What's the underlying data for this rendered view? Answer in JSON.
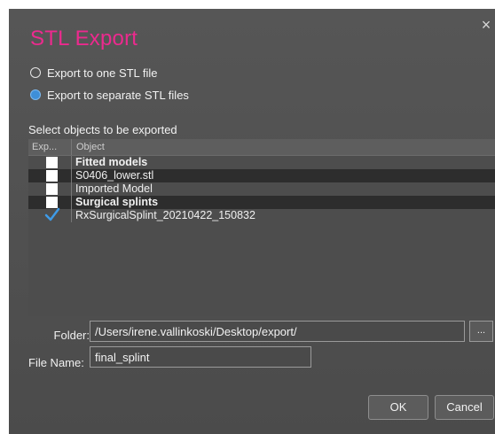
{
  "dialog": {
    "title": "STL Export",
    "close_glyph": "×",
    "title_color": "#ec2a8e"
  },
  "export_mode": {
    "options": [
      {
        "label": "Export to one STL file",
        "checked": false
      },
      {
        "label": "Export to separate STL files",
        "checked": true
      }
    ]
  },
  "objects": {
    "section_label": "Select objects to be exported",
    "columns": [
      "Exp...",
      "Object"
    ],
    "rows": [
      {
        "label": "Fitted models",
        "checked": false,
        "group_header": true
      },
      {
        "label": "S0406_lower.stl",
        "checked": false,
        "group_header": false
      },
      {
        "label": "Imported Model",
        "checked": false,
        "group_header": false
      },
      {
        "label": "Surgical splints",
        "checked": false,
        "group_header": true
      },
      {
        "label": "RxSurgicalSplint_20210422_150832",
        "checked": true,
        "group_header": false
      }
    ]
  },
  "folder": {
    "label": "Folder:",
    "value": "/Users/irene.vallinkoski/Desktop/export/",
    "browse_label": "..."
  },
  "file_name": {
    "label": "File Name:",
    "value": "final_splint"
  },
  "buttons": {
    "ok": "OK",
    "cancel": "Cancel"
  },
  "icons": {
    "checkbox_checked": "checkmark-icon",
    "close": "close-icon"
  }
}
